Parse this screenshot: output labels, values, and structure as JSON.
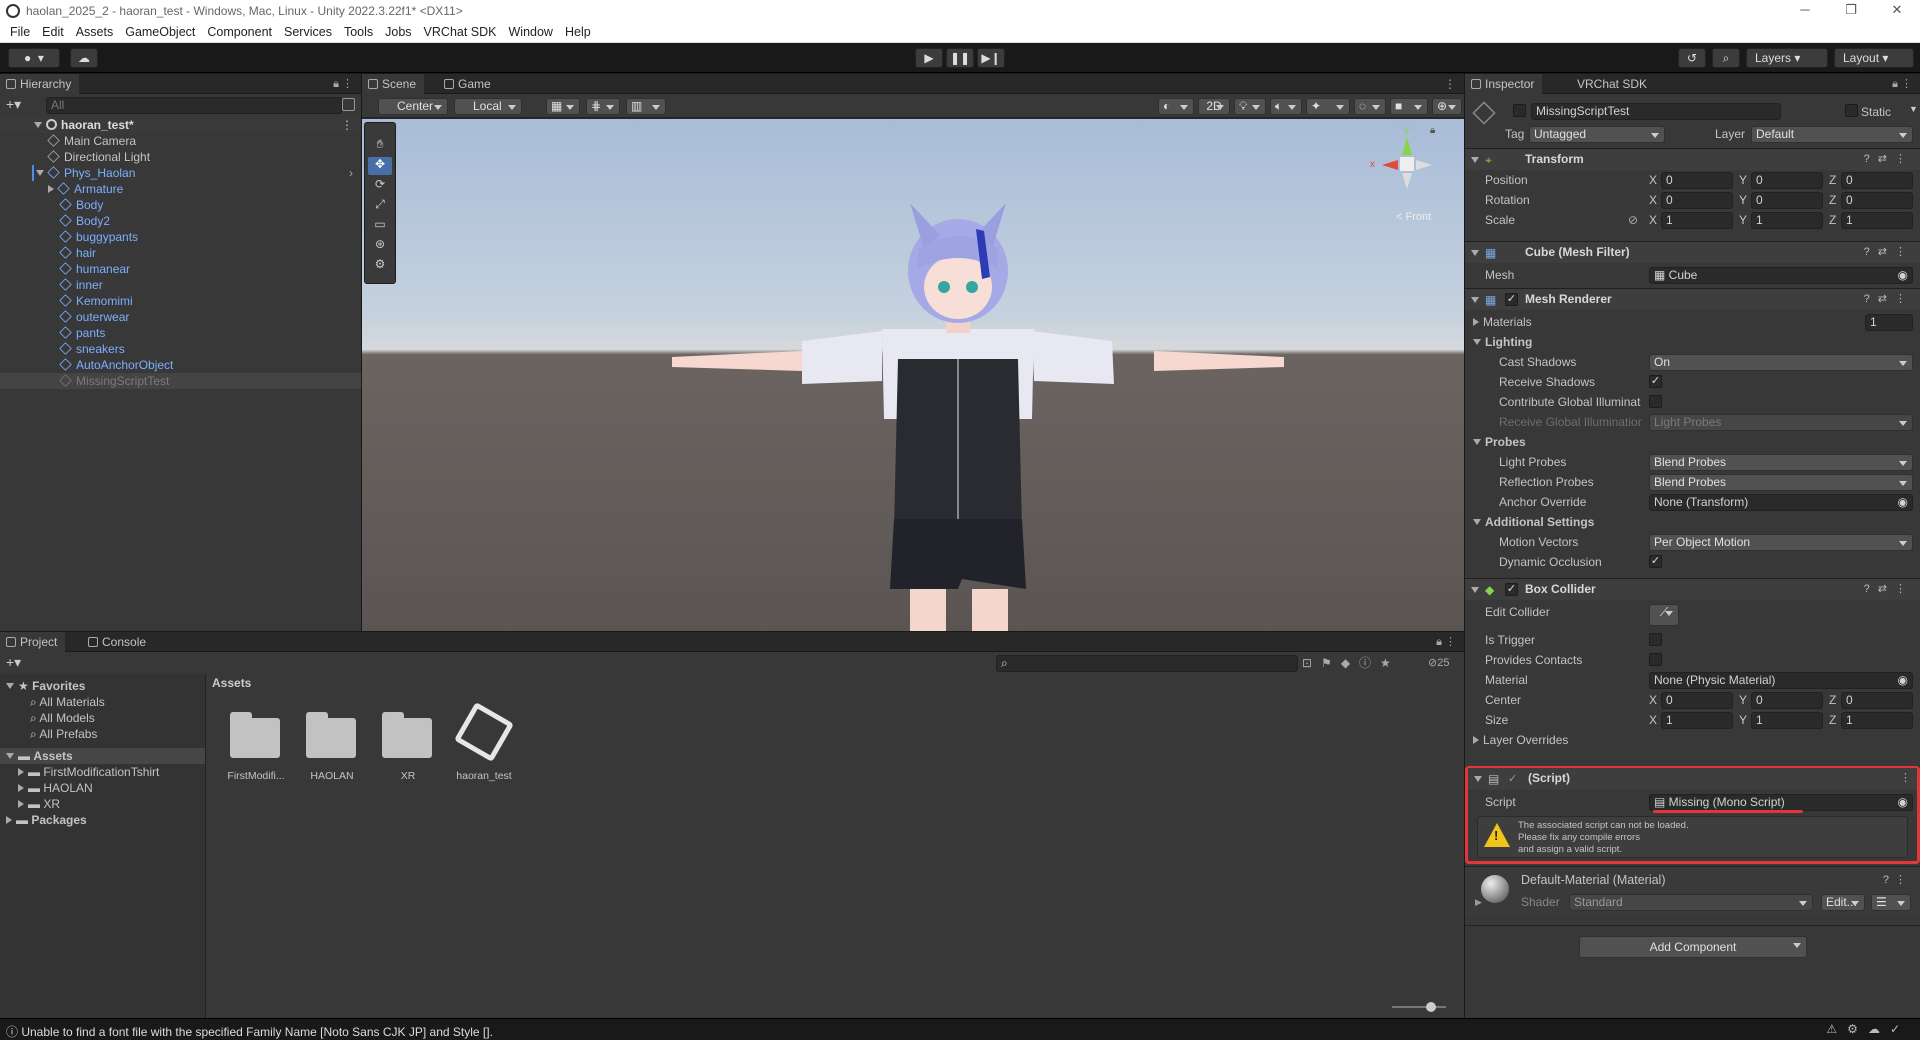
{
  "window": {
    "title": "haolan_2025_2 - haoran_test - Windows, Mac, Linux - Unity 2022.3.22f1* <DX11>"
  },
  "menu": [
    "File",
    "Edit",
    "Assets",
    "GameObject",
    "Component",
    "Services",
    "Tools",
    "Jobs",
    "VRChat SDK",
    "Window",
    "Help"
  ],
  "toolbar": {
    "layers": "Layers",
    "layout": "Layout"
  },
  "hierarchy": {
    "tab": "Hierarchy",
    "search_placeholder": "All",
    "scene": "haoran_test*",
    "items": [
      {
        "label": "Main Camera",
        "depth": 1,
        "style": "normal",
        "expandable": false
      },
      {
        "label": "Directional Light",
        "depth": 1,
        "style": "normal",
        "expandable": false
      },
      {
        "label": "Phys_Haolan",
        "depth": 1,
        "style": "blue",
        "expandable": true
      },
      {
        "label": "Armature",
        "depth": 2,
        "style": "blue",
        "expandable": true
      },
      {
        "label": "Body",
        "depth": 2,
        "style": "blue",
        "expandable": false
      },
      {
        "label": "Body2",
        "depth": 2,
        "style": "blue",
        "expandable": false
      },
      {
        "label": "buggypants",
        "depth": 2,
        "style": "blue",
        "expandable": false
      },
      {
        "label": "hair",
        "depth": 2,
        "style": "blue",
        "expandable": false
      },
      {
        "label": "humanear",
        "depth": 2,
        "style": "blue",
        "expandable": false
      },
      {
        "label": "inner",
        "depth": 2,
        "style": "blue",
        "expandable": false
      },
      {
        "label": "Kemomimi",
        "depth": 2,
        "style": "blue",
        "expandable": false
      },
      {
        "label": "outerwear",
        "depth": 2,
        "style": "blue",
        "expandable": false
      },
      {
        "label": "pants",
        "depth": 2,
        "style": "blue",
        "expandable": false
      },
      {
        "label": "sneakers",
        "depth": 2,
        "style": "blue",
        "expandable": false
      },
      {
        "label": "AutoAnchorObject",
        "depth": 2,
        "style": "blue",
        "expandable": false
      },
      {
        "label": "MissingScriptTest",
        "depth": 2,
        "style": "grey",
        "expandable": false
      }
    ]
  },
  "scene": {
    "tabs": [
      "Scene",
      "Game"
    ],
    "pivot": "Center",
    "space": "Local",
    "mode2d": "2D",
    "gizmo_label": "Front",
    "axes": [
      "x",
      "y"
    ]
  },
  "project": {
    "tabs": [
      "Project",
      "Console"
    ],
    "favorites_label": "Favorites",
    "favorites": [
      "All Materials",
      "All Models",
      "All Prefabs"
    ],
    "assets_label": "Assets",
    "asset_folders": [
      "FirstModificationTshirt",
      "HAOLAN",
      "XR"
    ],
    "packages_label": "Packages",
    "breadcrumb": "Assets",
    "grid_items": [
      {
        "label": "FirstModifi...",
        "kind": "folder"
      },
      {
        "label": "HAOLAN",
        "kind": "folder"
      },
      {
        "label": "XR",
        "kind": "folder"
      },
      {
        "label": "haoran_test",
        "kind": "unity"
      }
    ],
    "hidden_count": "25"
  },
  "inspector": {
    "tabs": [
      "Inspector",
      "VRChat SDK"
    ],
    "object_name": "MissingScriptTest",
    "static_label": "Static",
    "tag_label": "Tag",
    "tag_value": "Untagged",
    "layer_label": "Layer",
    "layer_value": "Default",
    "transform": {
      "title": "Transform",
      "rows": [
        {
          "label": "Position",
          "x": "0",
          "y": "0",
          "z": "0"
        },
        {
          "label": "Rotation",
          "x": "0",
          "y": "0",
          "z": "0"
        },
        {
          "label": "Scale",
          "x": "1",
          "y": "1",
          "z": "1"
        }
      ]
    },
    "mesh_filter": {
      "title": "Cube (Mesh Filter)",
      "mesh_label": "Mesh",
      "mesh_value": "Cube"
    },
    "mesh_renderer": {
      "title": "Mesh Renderer",
      "materials_label": "Materials",
      "materials_count": "1",
      "lighting_label": "Lighting",
      "cast_shadows_label": "Cast Shadows",
      "cast_shadows_value": "On",
      "receive_shadows_label": "Receive Shadows",
      "contribute_gi_label": "Contribute Global Illuminat",
      "receive_gi_label": "Receive Global Illuminatior",
      "receive_gi_value": "Light Probes",
      "probes_label": "Probes",
      "light_probes_label": "Light Probes",
      "light_probes_value": "Blend Probes",
      "reflection_probes_label": "Reflection Probes",
      "reflection_probes_value": "Blend Probes",
      "anchor_override_label": "Anchor Override",
      "anchor_override_value": "None (Transform)",
      "additional_label": "Additional Settings",
      "motion_vectors_label": "Motion Vectors",
      "motion_vectors_value": "Per Object Motion",
      "dynamic_occlusion_label": "Dynamic Occlusion"
    },
    "box_collider": {
      "title": "Box Collider",
      "edit_collider_label": "Edit Collider",
      "is_trigger_label": "Is Trigger",
      "provides_contacts_label": "Provides Contacts",
      "material_label": "Material",
      "material_value": "None (Physic Material)",
      "center_label": "Center",
      "center": {
        "x": "0",
        "y": "0",
        "z": "0"
      },
      "size_label": "Size",
      "size": {
        "x": "1",
        "y": "1",
        "z": "1"
      },
      "layer_overrides_label": "Layer Overrides"
    },
    "script": {
      "title": "(Script)",
      "script_label": "Script",
      "script_value": "Missing (Mono Script)",
      "warning_1": "The associated script can not be loaded.",
      "warning_2": "Please fix any compile errors",
      "warning_3": "and assign a valid script."
    },
    "material": {
      "title": "Default-Material (Material)",
      "shader_label": "Shader",
      "shader_value": "Standard",
      "edit_label": "Edit..."
    },
    "add_component": "Add Component",
    "highlight_color": "#e5343d"
  },
  "status": {
    "message": "Unable to find a font file with the specified Family Name [Noto Sans CJK JP] and Style []."
  }
}
